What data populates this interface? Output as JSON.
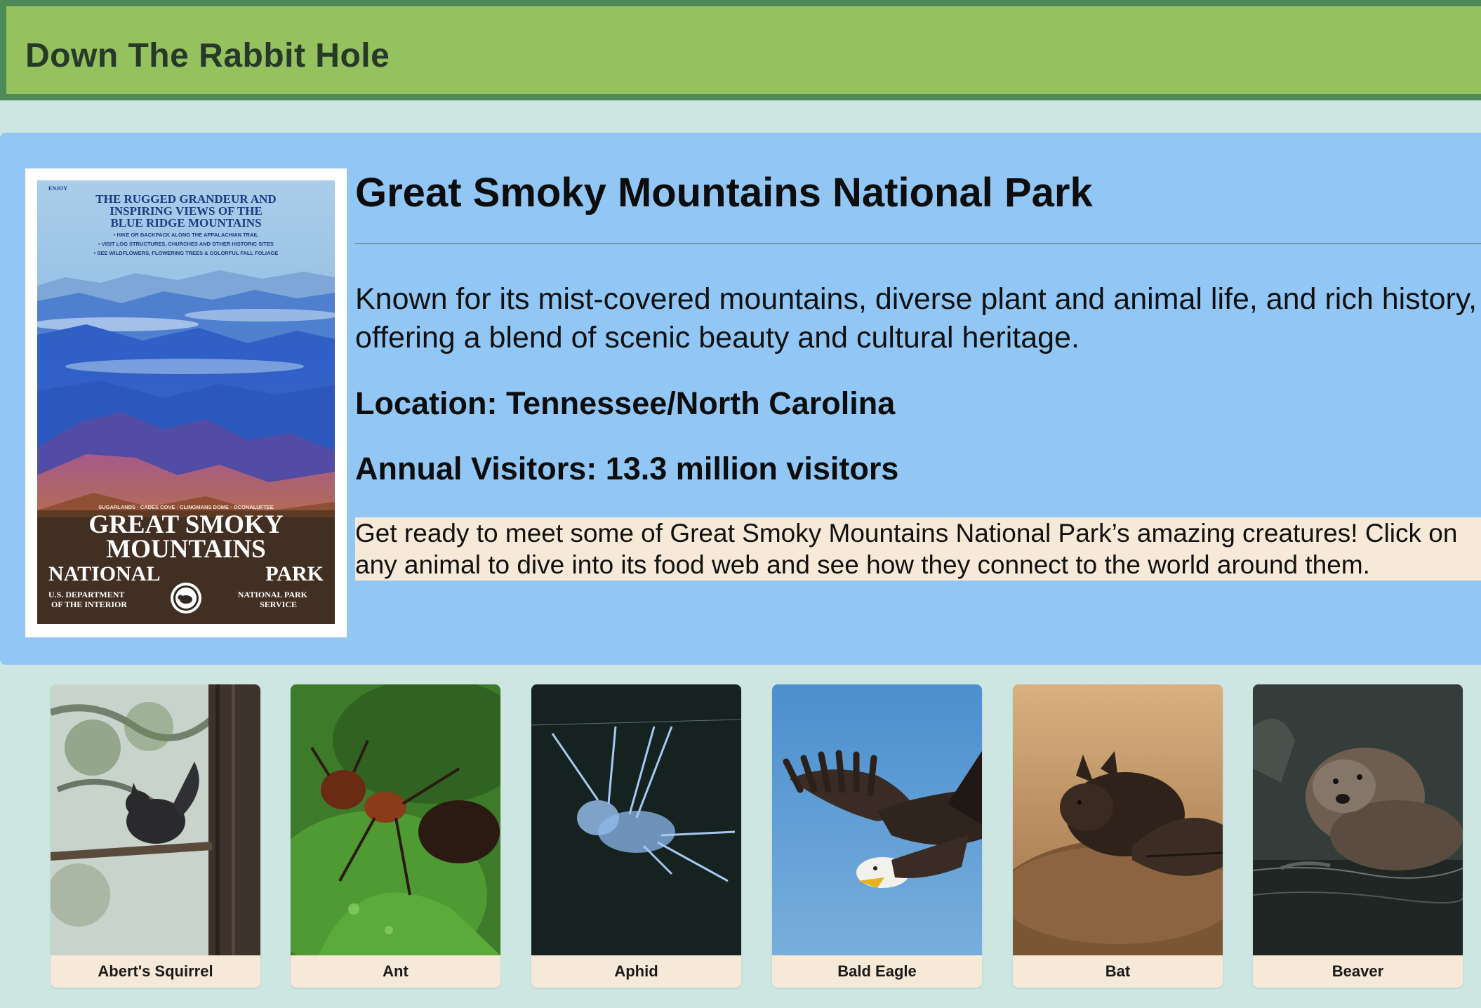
{
  "header": {
    "title": "Down The Rabbit Hole"
  },
  "park": {
    "title": "Great Smoky Mountains National Park",
    "description": "Known for its mist-covered mountains, diverse plant and animal life, and rich history, offering a blend of scenic beauty and cultural heritage.",
    "location": "Location: Tennessee/North Carolina",
    "visitors": "Annual Visitors: 13.3 million visitors",
    "prompt": "Get ready to meet some of Great Smoky Mountains National Park’s amazing creatures! Click on any animal to dive into its food web and see how they connect to the world around them.",
    "poster": {
      "enjoy": "ENJOY",
      "line1": "THE RUGGED GRANDEUR AND",
      "line2": "INSPIRING VIEWS OF THE",
      "line3": "BLUE RIDGE MOUNTAINS",
      "bullet1": "• HIKE OR BACKPACK ALONG THE APPALACHIAN TRAIL",
      "bullet2": "• VISIT LOG STRUCTURES, CHURCHES AND OTHER HISTORIC SITES",
      "bullet3": "• SEE WILDFLOWERS, FLOWERING TREES & COLORFUL FALL FOLIAGE",
      "places": "SUGARLANDS · CADES COVE · CLINGMANS DOME · OCONALUFTEE",
      "name1": "GREAT SMOKY",
      "name2": "MOUNTAINS",
      "name3a": "NATIONAL",
      "name3b": "PARK",
      "dept1": "U.S. DEPARTMENT",
      "dept2": "OF THE INTERIOR",
      "nps1": "NATIONAL PARK",
      "nps2": "SERVICE"
    }
  },
  "colors": {
    "header_bg": "#95c15e",
    "header_border": "#4e8a57",
    "page_bg": "#cde6e2",
    "panel_bg": "#92c7f5",
    "card_label_bg": "#f6e9d7"
  },
  "animals": [
    {
      "name": "Abert's Squirrel"
    },
    {
      "name": "Ant"
    },
    {
      "name": "Aphid"
    },
    {
      "name": "Bald Eagle"
    },
    {
      "name": "Bat"
    },
    {
      "name": "Beaver"
    }
  ]
}
